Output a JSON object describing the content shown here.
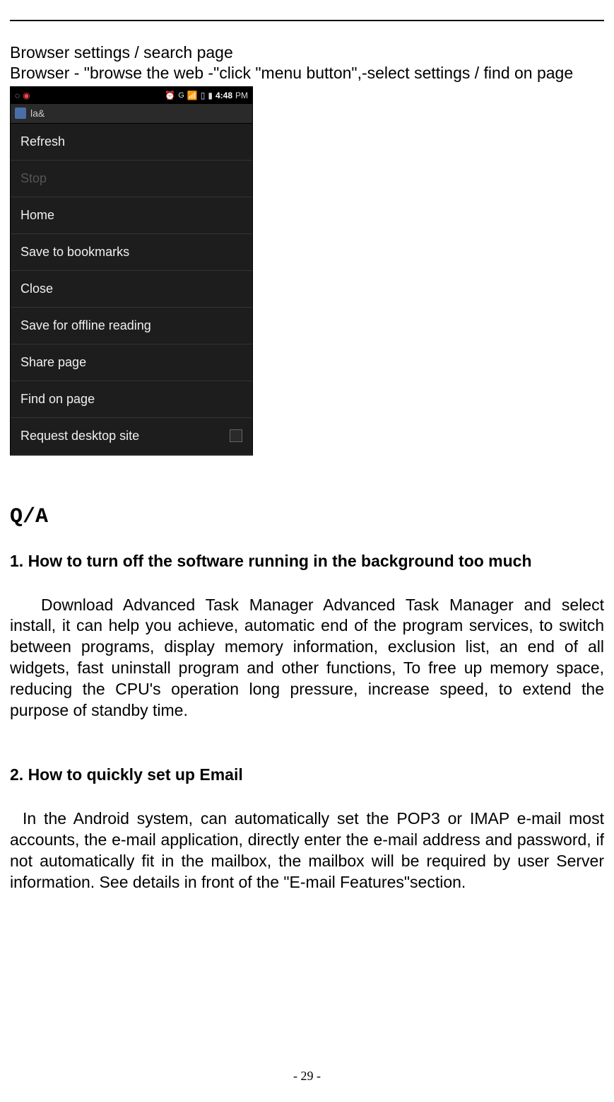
{
  "intro": {
    "line1": "Browser settings / search page",
    "line2": "Browser - \"browse the web -\"click \"menu button\",-select settings / find on page"
  },
  "screenshot": {
    "status": {
      "network_label": "G",
      "time": "4:48",
      "ampm": "PM"
    },
    "urlbar_text": "la&",
    "menu": [
      {
        "label": "Refresh",
        "disabled": false,
        "checkbox": false
      },
      {
        "label": "Stop",
        "disabled": true,
        "checkbox": false
      },
      {
        "label": "Home",
        "disabled": false,
        "checkbox": false
      },
      {
        "label": "Save to bookmarks",
        "disabled": false,
        "checkbox": false
      },
      {
        "label": "Close",
        "disabled": false,
        "checkbox": false
      },
      {
        "label": "Save for offline reading",
        "disabled": false,
        "checkbox": false
      },
      {
        "label": "Share page",
        "disabled": false,
        "checkbox": false
      },
      {
        "label": "Find on page",
        "disabled": false,
        "checkbox": false
      },
      {
        "label": "Request desktop site",
        "disabled": false,
        "checkbox": true
      }
    ]
  },
  "qa": {
    "heading": "Q/A",
    "q1": {
      "title": "1. How to turn off the software running in the background too much",
      "body": "Download Advanced Task Manager Advanced Task Manager and select install, it can help you achieve, automatic end of the program services, to switch between programs, display memory information, exclusion list, an end of all widgets, fast uninstall program and other functions, To free up memory space, reducing the CPU's operation long pressure, increase speed, to extend the purpose of standby time."
    },
    "q2": {
      "title": "2. How to quickly set up Email",
      "body": "In the Android system, can automatically set the POP3 or IMAP e-mail most accounts, the e-mail application, directly enter the e-mail address and password, if not automatically fit in the mailbox, the mailbox will be required by user Server information. See details in front of the \"E-mail Features\"section."
    }
  },
  "page_number": "- 29 -"
}
